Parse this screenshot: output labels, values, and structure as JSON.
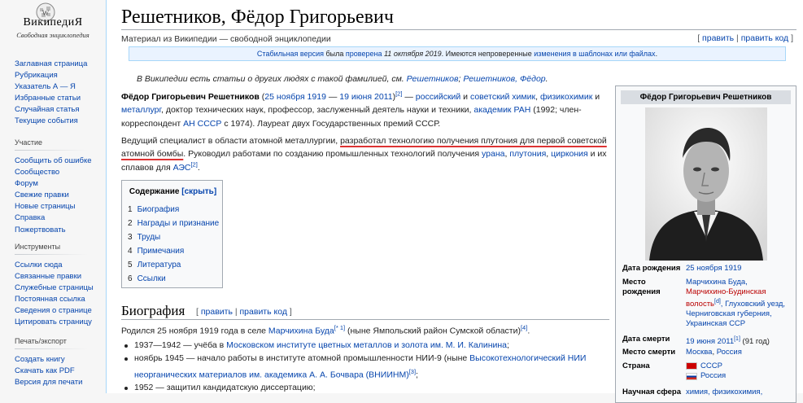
{
  "logo": {
    "wordmark": "ВикипедиЯ",
    "tagline": "Свободная энциклопедия"
  },
  "nav": {
    "main": [
      "Заглавная страница",
      "Рубрикация",
      "Указатель А — Я",
      "Избранные статьи",
      "Случайная статья",
      "Текущие события"
    ],
    "participation": {
      "heading": "Участие",
      "items": [
        "Сообщить об ошибке",
        "Сообщество",
        "Форум",
        "Свежие правки",
        "Новые страницы",
        "Справка",
        "Пожертвовать"
      ]
    },
    "tools": {
      "heading": "Инструменты",
      "items": [
        "Ссылки сюда",
        "Связанные правки",
        "Служебные страницы",
        "Постоянная ссылка",
        "Сведения о странице",
        "Цитировать страницу"
      ]
    },
    "print": {
      "heading": "Печать/экспорт",
      "items": [
        "Создать книгу",
        "Скачать как PDF",
        "Версия для печати"
      ]
    }
  },
  "article": {
    "title": "Решетников, Фёдор Григорьевич",
    "tagline": "Материал из Википедии — свободной энциклопедии",
    "edit_links": {
      "open": "[",
      "edit": "править",
      "sep": " | ",
      "edit_code": "править код",
      "close": "]"
    },
    "flagged": {
      "p1": "Стабильная версия",
      "p2": " была ",
      "p3": "проверена",
      "p4": " 11 октября 2019",
      "p5": ". Имеются непроверенные ",
      "p6": "изменения в шаблонах или файлах",
      "p7": "."
    },
    "hatnote": {
      "p1": "В Википедии есть статьи о других людях с такой фамилией, см. ",
      "l1": "Решетников",
      "s1": "; ",
      "l2": "Решетников, Фёдор",
      "s2": "."
    },
    "lead1": {
      "name": "Фёдор Григорьевич Решетников",
      "t1": " (",
      "born": "25 ноября 1919",
      "t2": " — ",
      "died": "19 июня 2011",
      "t3": ")",
      "ref1": "[2]",
      "t4": " — ",
      "l_chem": "российский",
      "t5": " и ",
      "l_sov": "советский химик",
      "t6": ", ",
      "l_phys": "физикохимик",
      "t7": " и ",
      "l_met": "металлург",
      "t8": ", доктор технических наук, профессор, заслуженный деятель науки и техники, ",
      "l_acad": "академик РАН",
      "t9": " (1992; член-корреспондент ",
      "l_an": "АН СССР",
      "t10": " с 1974). Лауреат двух Государственных премий СССР."
    },
    "lead2": {
      "t1": "Ведущий специалист в области атомной металлургии, ",
      "under": "разработал технологию получения плутония для первой советской атомной бомбы",
      "t2": ". Руководил работами по созданию промышленных технологий получения ",
      "l_u": "урана",
      "s1": ", ",
      "l_pu": "плутония",
      "s2": ", ",
      "l_zr": "циркония",
      "t3": " и их сплавов для ",
      "l_aes": "АЭС",
      "ref": "[2]",
      "t4": "."
    },
    "toc": {
      "title": "Содержание",
      "toggle": "[скрыть]",
      "items": [
        {
          "num": "1",
          "label": "Биография"
        },
        {
          "num": "2",
          "label": "Награды и признание"
        },
        {
          "num": "3",
          "label": "Труды"
        },
        {
          "num": "4",
          "label": "Примечания"
        },
        {
          "num": "5",
          "label": "Литература"
        },
        {
          "num": "6",
          "label": "Ссылки"
        }
      ]
    },
    "section": {
      "heading": "Биография",
      "edit_open": "[ ",
      "edit": "править",
      "sep": " | ",
      "edit_code": "править код",
      "edit_close": " ]",
      "born": {
        "t1": "Родился 25 ноября 1919 года в селе ",
        "village": "Марчихина Буда",
        "ref": "[* 1]",
        "t2": " (ныне Ямпольский район Сумской области)",
        "ref2": "[4]",
        "t3": "."
      },
      "bullets": [
        {
          "t1": "1937—1942 — учёба в ",
          "link": "Московском институте цветных металлов и золота им. М. И. Калинина",
          "t2": ";"
        },
        {
          "t1": "ноябрь 1945 — начало работы в институте атомной промышленности НИИ-9 (ныне ",
          "link": "Высокотехнологический НИИ",
          "t2": ""
        },
        {
          "t1": "",
          "link": "неорганических материалов им. академика А. А. Бочвара (ВНИИНМ)",
          "t2": "",
          "ref": "[3]",
          "t3": ";"
        },
        {
          "t1": "1952 — защитил кандидатскую диссертацию;",
          "link": "",
          "t2": ""
        }
      ]
    }
  },
  "infobox": {
    "title": "Фёдор Григорьевич Решетников",
    "birth_date_label": "Дата рождения",
    "birth_date": "25 ноября 1919",
    "birth_place_label_1": "Место",
    "birth_place_label_2": "рождения",
    "bp1": "Марчихина Буда,",
    "bp2": "Марчихино-Будинская",
    "bp3": "волость",
    "bp3_ref": "[d]",
    "bp3b": ", Глуховский уезд,",
    "bp4": "Черниговская губерния,",
    "bp5": "Украинская ССР",
    "death_date_label": "Дата смерти",
    "death_date": "19 июня 2011",
    "death_ref": "[1]",
    "death_age": " (91 год)",
    "death_place_label": "Место смерти",
    "death_place_1": "Москва",
    "death_place_sep": ", ",
    "death_place_2": "Россия",
    "country_label": "Страна",
    "country_1": "СССР",
    "country_2": "Россия",
    "field_label": "Научная сфера",
    "field_value": "химия, физикохимия,"
  },
  "colors": {
    "link": "#0645ad",
    "redlink": "#ba0000",
    "underline": "#dd3333"
  }
}
